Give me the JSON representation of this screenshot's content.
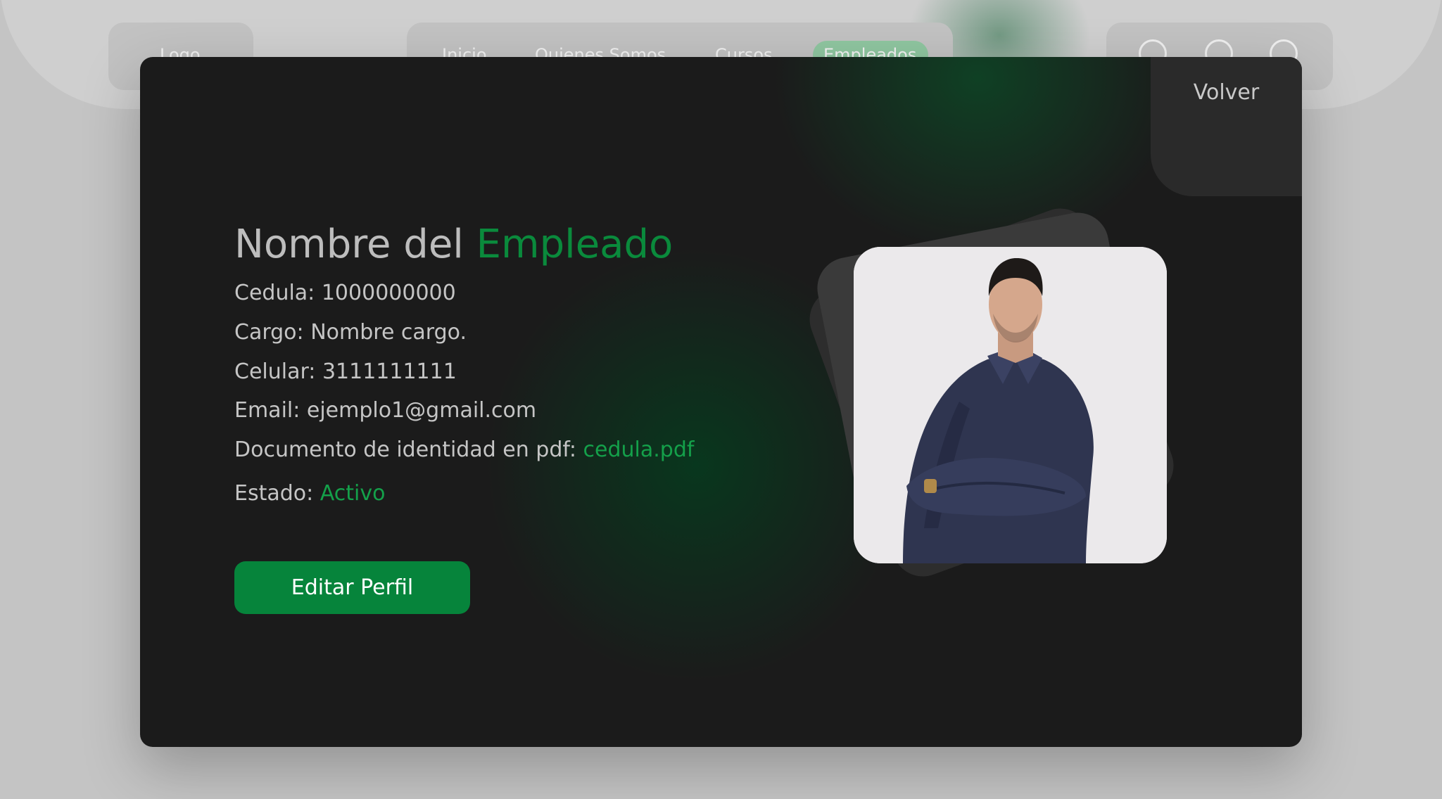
{
  "nav": {
    "logo": "Logo",
    "links": [
      "Inicio",
      "Quienes Somos",
      "Cursos",
      "Empleados"
    ],
    "active": "Empleados",
    "icons": [
      "settings-icon",
      "bell-icon",
      "user-icon"
    ]
  },
  "modal": {
    "back_label": "Volver",
    "title_prefix": "Nombre del",
    "title_accent": "Empleado",
    "fields": {
      "cedula_label": "Cedula:",
      "cedula_value": "1000000000",
      "cargo_label": "Cargo:",
      "cargo_value": "Nombre cargo.",
      "celular_label": "Celular:",
      "celular_value": "3111111111",
      "email_label": "Email:",
      "email_value": "ejemplo1@gmail.com",
      "documento_label": "Documento de identidad en pdf:",
      "documento_value": "cedula.pdf",
      "estado_label": "Estado:",
      "estado_value": "Activo"
    },
    "edit_button": "Editar Perfil"
  },
  "colors": {
    "accent": "#0a8a3c",
    "modal_bg": "#1b1b1b",
    "button": "#06843b"
  }
}
